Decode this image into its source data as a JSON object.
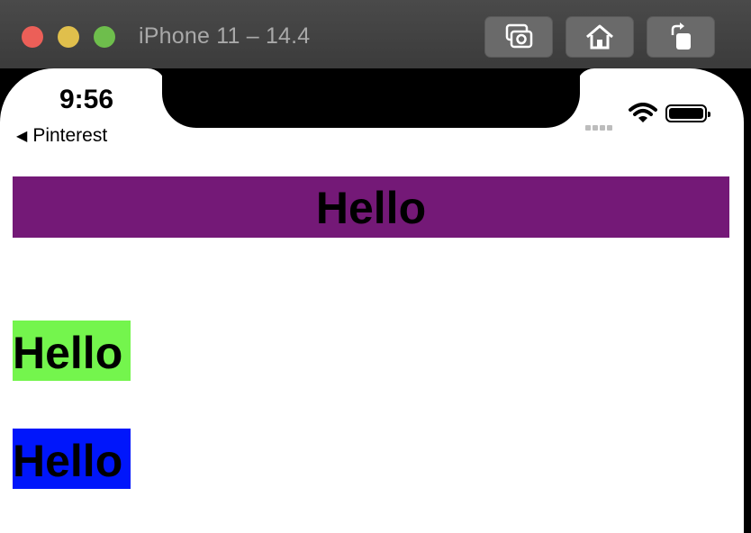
{
  "simulator": {
    "title": "iPhone 11 – 14.4",
    "buttons": [
      "screenshot-button",
      "home-button",
      "rotate-button"
    ]
  },
  "status_bar": {
    "time": "9:56",
    "back_label": "Pinterest",
    "back_icon": "triangle-left-icon"
  },
  "app": {
    "banner_text": "Hello",
    "green_text": "Hello",
    "blue_text": "Hello",
    "colors": {
      "banner_bg": "#741977",
      "green_bg": "#74f54d",
      "blue_bg": "#0016fb"
    }
  }
}
